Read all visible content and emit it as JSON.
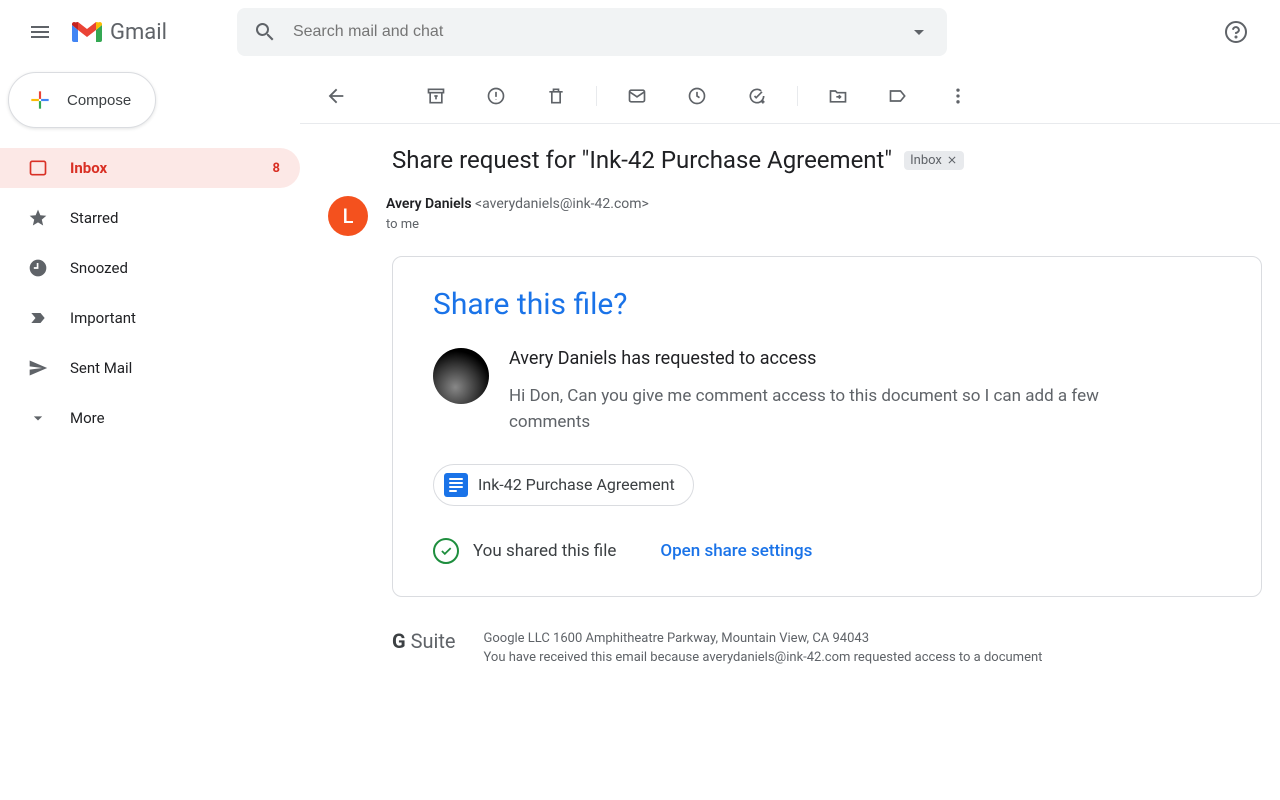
{
  "header": {
    "app_name": "Gmail",
    "search_placeholder": "Search mail and chat"
  },
  "compose_label": "Compose",
  "sidebar": {
    "items": [
      {
        "label": "Inbox",
        "count": "8"
      },
      {
        "label": "Starred"
      },
      {
        "label": "Snoozed"
      },
      {
        "label": "Important"
      },
      {
        "label": "Sent Mail"
      },
      {
        "label": "More"
      }
    ]
  },
  "message": {
    "subject": "Share request for \"Ink-42 Purchase Agreement\"",
    "badge_label": "Inbox",
    "sender_name": "Avery Daniels",
    "sender_email": "<averydaniels@ink-42.com>",
    "to_line": "to me",
    "avatar_initial": "L"
  },
  "card": {
    "title": "Share this file?",
    "request_line": "Avery Daniels has requested to access",
    "request_body": "Hi Don, Can you give me comment access to this document so I can add a few comments",
    "file_name": "Ink-42 Purchase Agreement",
    "status_text": "You shared this file",
    "open_link": "Open share settings"
  },
  "footer": {
    "brand": "G Suite",
    "line1": "Google LLC 1600 Amphitheatre Parkway, Mountain View, CA 94043",
    "line2": "You have received this email because averydaniels@ink-42.com requested access to a document"
  }
}
